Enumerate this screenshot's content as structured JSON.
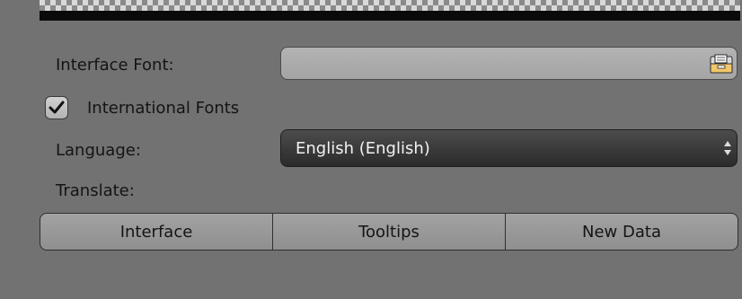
{
  "interface_font": {
    "label": "Interface Font:",
    "value": "",
    "button_icon": "folder-icon"
  },
  "international_fonts": {
    "label": "International Fonts",
    "checked": true
  },
  "language": {
    "label": "Language:",
    "value": "English (English)"
  },
  "translate": {
    "label": "Translate:",
    "buttons": [
      "Interface",
      "Tooltips",
      "New Data"
    ]
  },
  "colors": {
    "panel_bg": "#727272",
    "dropdown_bg": "#3a3a3a",
    "dropdown_text": "#f2f2f2"
  }
}
